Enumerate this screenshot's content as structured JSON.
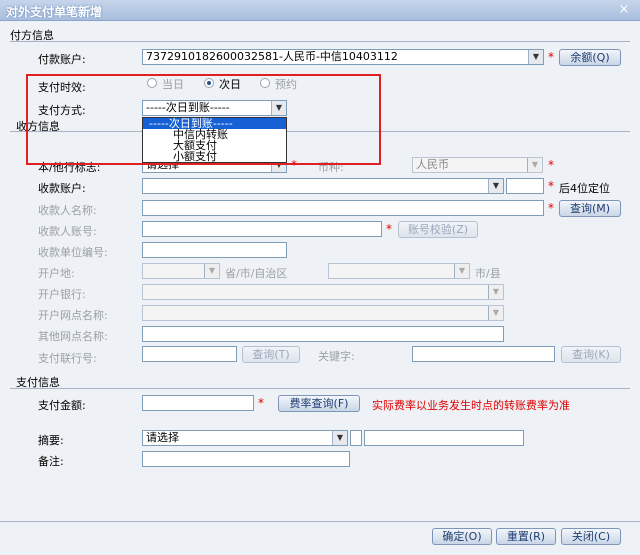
{
  "window": {
    "title": "对外支付单笔新增",
    "close": "×"
  },
  "payer_section": {
    "title": "付方信息",
    "account_label": "付款账户:",
    "account_value": "7372910182600032581-人民币-中信10403112",
    "balance_button": "余额(Q)",
    "timing_label": "支付时效:",
    "timing_options": [
      "当日",
      "次日",
      "预约"
    ],
    "timing_selected": "次日",
    "method_label": "支付方式:",
    "method_value": "-----次日到账-----",
    "method_options": [
      "-----次日到账-----",
      "中信内转账",
      "大额支付",
      "小额支付"
    ]
  },
  "payee_section": {
    "title": "收方信息",
    "bank_flag_label": "本/他行标志:",
    "bank_flag_value": "请选择",
    "currency_label": "币种:",
    "currency_value": "人民币",
    "account_label": "收款账户:",
    "last4_label": "后4位定位",
    "name_label": "收款人名称:",
    "query_button": "查询(M)",
    "id_label": "收款人账号:",
    "verify_button": "账号校验(Z)",
    "unit_code_label": "收款单位编号:",
    "location_label": "开户地:",
    "province_suffix": "省/市/自治区",
    "city_suffix": "市/县",
    "open_bank_label": "开户银行:",
    "branch_label": "开户网点名称:",
    "other_branch_label": "其他网点名称:",
    "clearing_label": "支付联行号:",
    "clearing_query_button": "查询(T)",
    "keyword_label": "关键字:",
    "keyword_query_button": "查询(K)"
  },
  "payment_section": {
    "title": "支付信息",
    "amount_label": "支付金额:",
    "rate_button": "费率查询(F)",
    "rate_hint": "实际费率以业务发生时点的转账费率为准",
    "summary_label": "摘要:",
    "summary_value": "请选择",
    "note_label": "备注:"
  },
  "footer": {
    "confirm": "确定(O)",
    "reset": "重置(R)",
    "close": "关闭(C)"
  }
}
